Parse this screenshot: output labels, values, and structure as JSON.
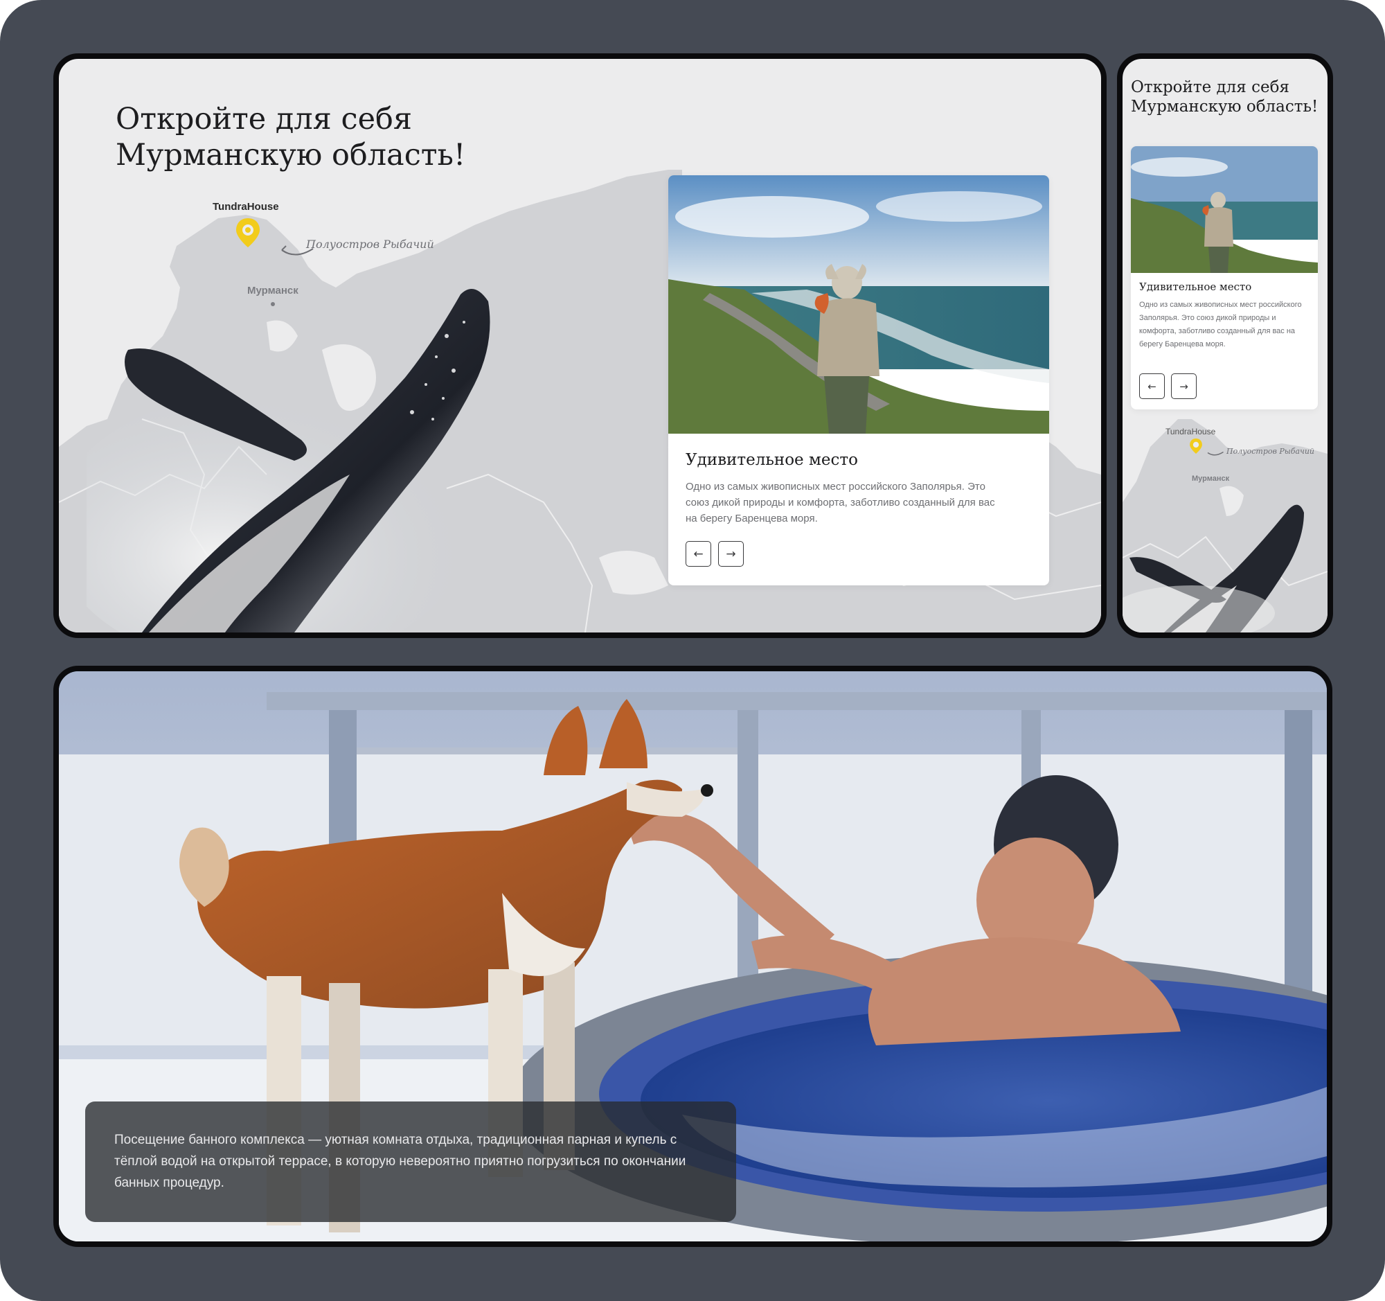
{
  "desktop": {
    "headline_line1": "Откройте для себя",
    "headline_line2": "Мурманскую область!",
    "pin_label": "TundraHouse",
    "city_label": "Мурманск",
    "handwritten_note": "Полуостров Рыбачий",
    "card": {
      "title": "Удивительное место",
      "text": "Одно из самых живописных мест российского Заполярья. Это союз дикой природы и комфорта, заботливо созданный для вас на берегу Баренцева моря.",
      "prev_icon": "←",
      "next_icon": "→"
    }
  },
  "mobile": {
    "headline_line1": "Откройте для себя",
    "headline_line2": "Мурманскую область!",
    "pin_label": "TundraHouse",
    "city_label": "Мурманск",
    "handwritten_note": "Полуостров Рыбачий",
    "card": {
      "title": "Удивительное место",
      "text": "Одно из самых живописных мест российского Заполярья. Это союз дикой природы и комфорта, заботливо созданный для вас на берегу Баренцева моря.",
      "prev_icon": "←",
      "next_icon": "→"
    }
  },
  "sauna": {
    "caption": "Посещение банного комплекса — уютная комната отдыха, традиционная парная и купель с тёплой водой на открытой террасе, в которую невероятно приятно погрузиться по окончании банных процедур."
  },
  "colors": {
    "board_background": "#454a54",
    "map_background": "#ececed",
    "pin_yellow": "#f2cc1b",
    "card_background": "#ffffff"
  },
  "icons": [
    "map-pin-icon",
    "arrow-left-icon",
    "arrow-right-icon",
    "curved-arrow-icon"
  ]
}
